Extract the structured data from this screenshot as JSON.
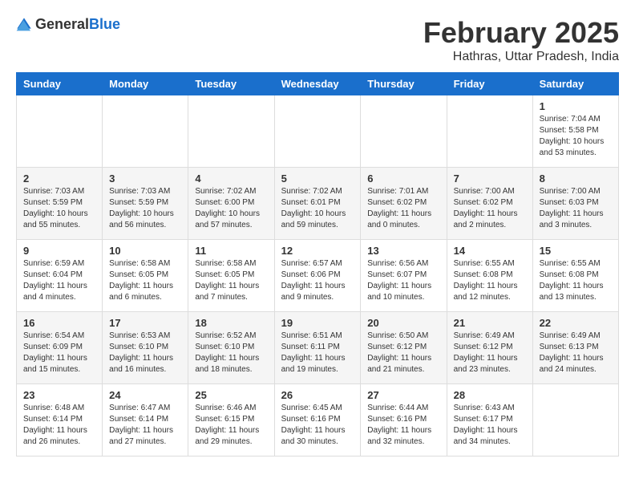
{
  "logo": {
    "text_general": "General",
    "text_blue": "Blue"
  },
  "header": {
    "month_year": "February 2025",
    "location": "Hathras, Uttar Pradesh, India"
  },
  "weekdays": [
    "Sunday",
    "Monday",
    "Tuesday",
    "Wednesday",
    "Thursday",
    "Friday",
    "Saturday"
  ],
  "weeks": [
    [
      {
        "day": "",
        "info": ""
      },
      {
        "day": "",
        "info": ""
      },
      {
        "day": "",
        "info": ""
      },
      {
        "day": "",
        "info": ""
      },
      {
        "day": "",
        "info": ""
      },
      {
        "day": "",
        "info": ""
      },
      {
        "day": "1",
        "info": "Sunrise: 7:04 AM\nSunset: 5:58 PM\nDaylight: 10 hours\nand 53 minutes."
      }
    ],
    [
      {
        "day": "2",
        "info": "Sunrise: 7:03 AM\nSunset: 5:59 PM\nDaylight: 10 hours\nand 55 minutes."
      },
      {
        "day": "3",
        "info": "Sunrise: 7:03 AM\nSunset: 5:59 PM\nDaylight: 10 hours\nand 56 minutes."
      },
      {
        "day": "4",
        "info": "Sunrise: 7:02 AM\nSunset: 6:00 PM\nDaylight: 10 hours\nand 57 minutes."
      },
      {
        "day": "5",
        "info": "Sunrise: 7:02 AM\nSunset: 6:01 PM\nDaylight: 10 hours\nand 59 minutes."
      },
      {
        "day": "6",
        "info": "Sunrise: 7:01 AM\nSunset: 6:02 PM\nDaylight: 11 hours\nand 0 minutes."
      },
      {
        "day": "7",
        "info": "Sunrise: 7:00 AM\nSunset: 6:02 PM\nDaylight: 11 hours\nand 2 minutes."
      },
      {
        "day": "8",
        "info": "Sunrise: 7:00 AM\nSunset: 6:03 PM\nDaylight: 11 hours\nand 3 minutes."
      }
    ],
    [
      {
        "day": "9",
        "info": "Sunrise: 6:59 AM\nSunset: 6:04 PM\nDaylight: 11 hours\nand 4 minutes."
      },
      {
        "day": "10",
        "info": "Sunrise: 6:58 AM\nSunset: 6:05 PM\nDaylight: 11 hours\nand 6 minutes."
      },
      {
        "day": "11",
        "info": "Sunrise: 6:58 AM\nSunset: 6:05 PM\nDaylight: 11 hours\nand 7 minutes."
      },
      {
        "day": "12",
        "info": "Sunrise: 6:57 AM\nSunset: 6:06 PM\nDaylight: 11 hours\nand 9 minutes."
      },
      {
        "day": "13",
        "info": "Sunrise: 6:56 AM\nSunset: 6:07 PM\nDaylight: 11 hours\nand 10 minutes."
      },
      {
        "day": "14",
        "info": "Sunrise: 6:55 AM\nSunset: 6:08 PM\nDaylight: 11 hours\nand 12 minutes."
      },
      {
        "day": "15",
        "info": "Sunrise: 6:55 AM\nSunset: 6:08 PM\nDaylight: 11 hours\nand 13 minutes."
      }
    ],
    [
      {
        "day": "16",
        "info": "Sunrise: 6:54 AM\nSunset: 6:09 PM\nDaylight: 11 hours\nand 15 minutes."
      },
      {
        "day": "17",
        "info": "Sunrise: 6:53 AM\nSunset: 6:10 PM\nDaylight: 11 hours\nand 16 minutes."
      },
      {
        "day": "18",
        "info": "Sunrise: 6:52 AM\nSunset: 6:10 PM\nDaylight: 11 hours\nand 18 minutes."
      },
      {
        "day": "19",
        "info": "Sunrise: 6:51 AM\nSunset: 6:11 PM\nDaylight: 11 hours\nand 19 minutes."
      },
      {
        "day": "20",
        "info": "Sunrise: 6:50 AM\nSunset: 6:12 PM\nDaylight: 11 hours\nand 21 minutes."
      },
      {
        "day": "21",
        "info": "Sunrise: 6:49 AM\nSunset: 6:12 PM\nDaylight: 11 hours\nand 23 minutes."
      },
      {
        "day": "22",
        "info": "Sunrise: 6:49 AM\nSunset: 6:13 PM\nDaylight: 11 hours\nand 24 minutes."
      }
    ],
    [
      {
        "day": "23",
        "info": "Sunrise: 6:48 AM\nSunset: 6:14 PM\nDaylight: 11 hours\nand 26 minutes."
      },
      {
        "day": "24",
        "info": "Sunrise: 6:47 AM\nSunset: 6:14 PM\nDaylight: 11 hours\nand 27 minutes."
      },
      {
        "day": "25",
        "info": "Sunrise: 6:46 AM\nSunset: 6:15 PM\nDaylight: 11 hours\nand 29 minutes."
      },
      {
        "day": "26",
        "info": "Sunrise: 6:45 AM\nSunset: 6:16 PM\nDaylight: 11 hours\nand 30 minutes."
      },
      {
        "day": "27",
        "info": "Sunrise: 6:44 AM\nSunset: 6:16 PM\nDaylight: 11 hours\nand 32 minutes."
      },
      {
        "day": "28",
        "info": "Sunrise: 6:43 AM\nSunset: 6:17 PM\nDaylight: 11 hours\nand 34 minutes."
      },
      {
        "day": "",
        "info": ""
      }
    ]
  ]
}
